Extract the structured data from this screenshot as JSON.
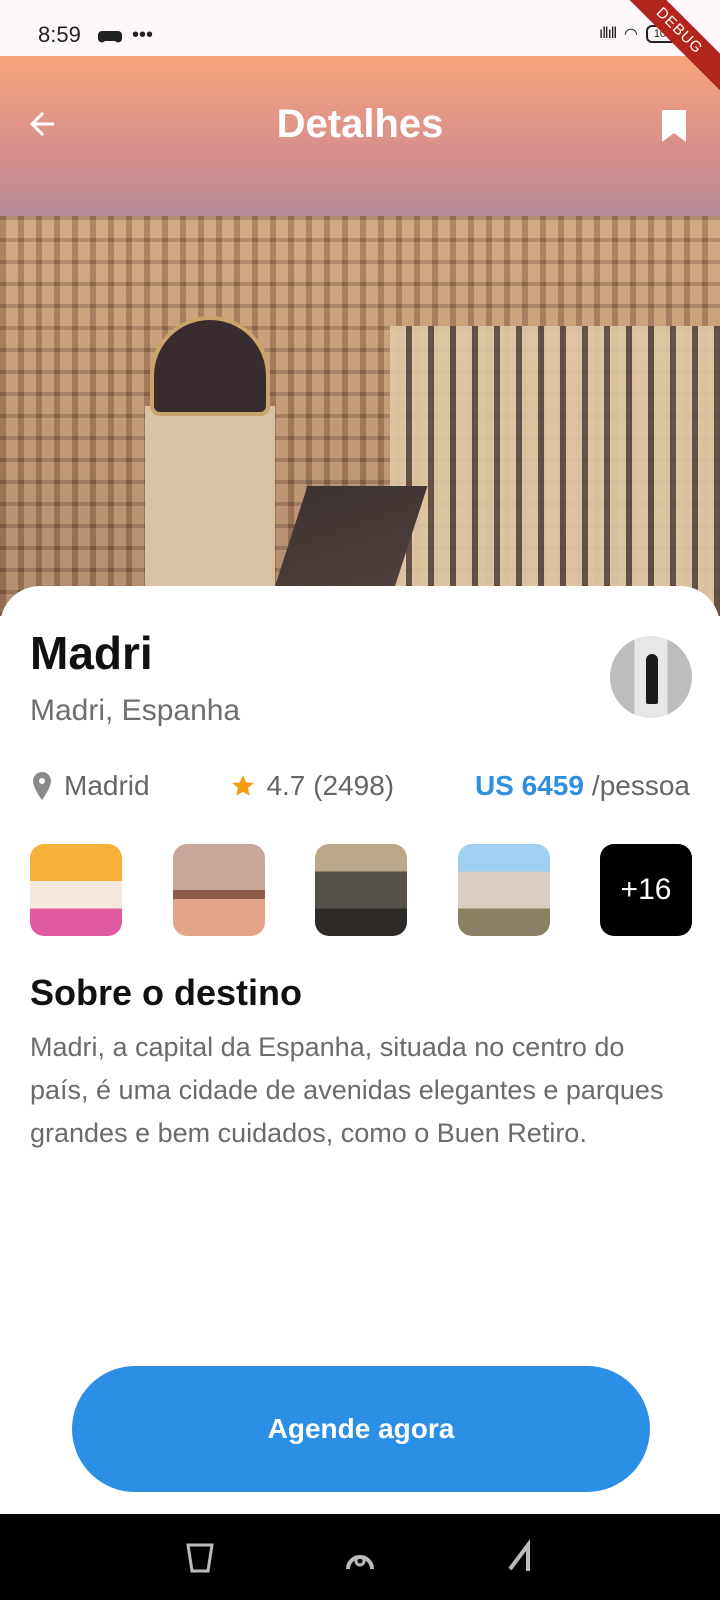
{
  "status_bar": {
    "time": "8:59",
    "battery": "100",
    "debug_label": "DEBUG"
  },
  "header": {
    "title": "Detalhes"
  },
  "place": {
    "title": "Madri",
    "subtitle": "Madri, Espanha",
    "location": "Madrid",
    "rating": "4.7 (2498)",
    "price": "US 6459",
    "per_unit": "/pessoa"
  },
  "gallery": {
    "more_label": "+16"
  },
  "about": {
    "heading": "Sobre o destino",
    "text": "Madri, a capital da Espanha, situada no centro do país, é uma cidade de avenidas elegantes e parques grandes e bem cuidados, como o Buen Retiro."
  },
  "cta": {
    "label": "Agende agora"
  },
  "colors": {
    "accent": "#2b8fe6",
    "star": "#f39c12",
    "debug": "#b3261e"
  }
}
